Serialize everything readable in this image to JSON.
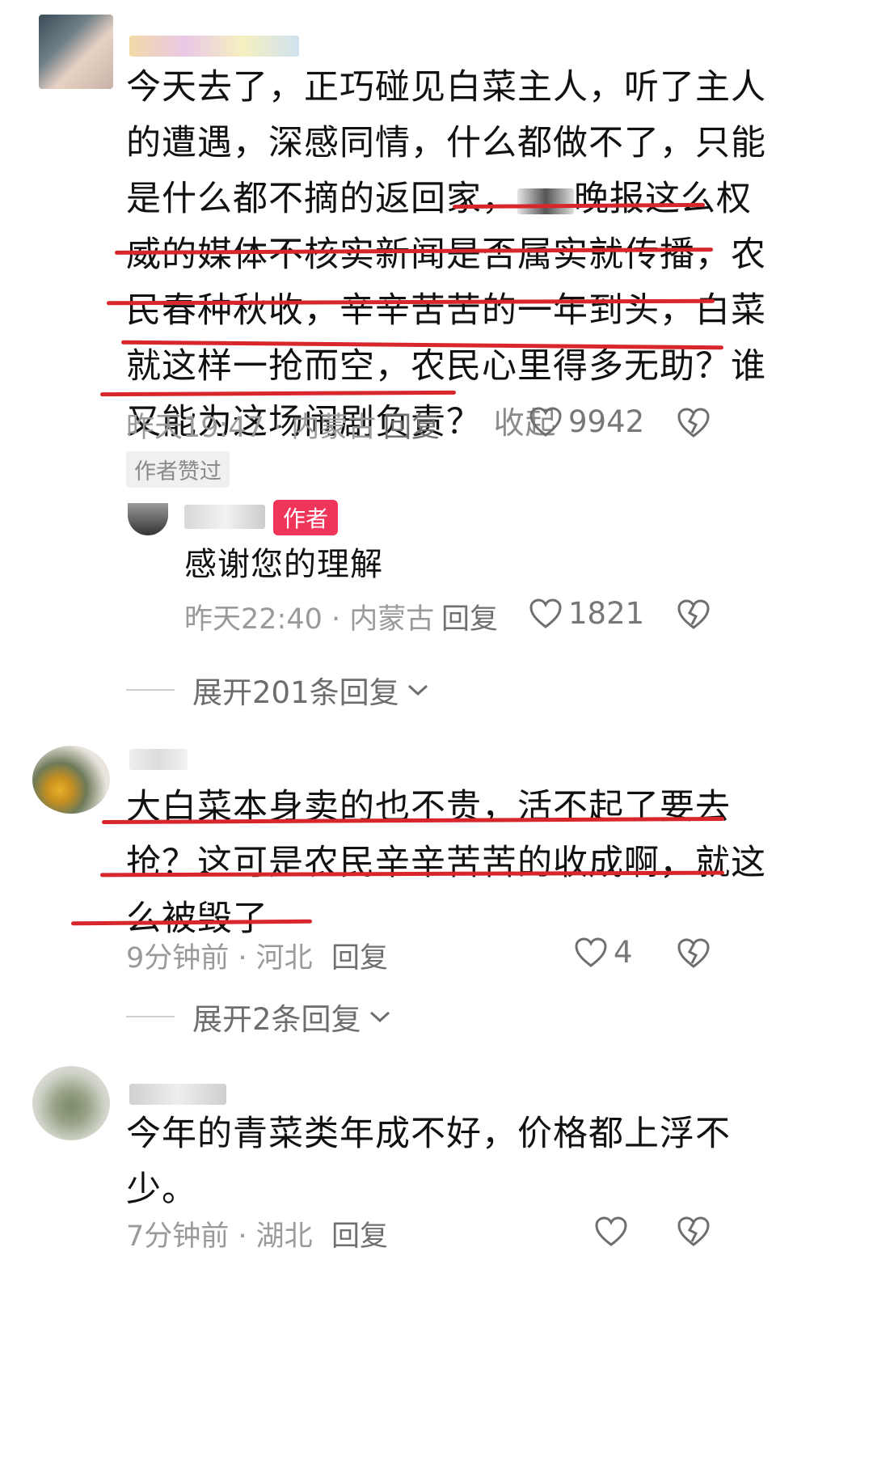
{
  "comments": [
    {
      "text_lines": [
        "今天去了，正巧碰见白菜主人，听了主人",
        "的遭遇，深感同情，什么都做不了，只能",
        "是什么都不摘的返回家，",
        "威的媒体不核实新闻是否属实就传播，农",
        "民春种秋收，辛辛苦苦的一年到头，白菜",
        "就这样一抢而空，农民心里得多无助？谁",
        "又能为这场闹剧负责？"
      ],
      "line3_tail": "晚报这么权",
      "collapse_label": "收起",
      "meta": "昨天19:47 · 内蒙古",
      "reply_label": "回复",
      "likes": "9942",
      "author_liked_badge": "作者赞过",
      "reply": {
        "author_tag": "作者",
        "text": "感谢您的理解",
        "meta": "昨天22:40 · 内蒙古",
        "reply_label": "回复",
        "likes": "1821"
      },
      "expand_label": "展开201条回复"
    },
    {
      "text_lines": [
        "大白菜本身卖的也不贵，活不起了要去",
        "抢？这可是农民辛辛苦苦的收成啊，就这",
        "么被毁了"
      ],
      "meta": "9分钟前 · 河北",
      "reply_label": "回复",
      "likes": "4",
      "expand_label": "展开2条回复"
    },
    {
      "text_lines": [
        "今年的青菜类年成不好，价格都上浮不",
        "少。"
      ],
      "meta": "7分钟前 · 湖北",
      "reply_label": "回复"
    }
  ],
  "colors": {
    "underline": "#d7262c",
    "author_tag": "#f0355a",
    "meta_text": "#9a9a9a"
  },
  "icons": [
    "heart-icon",
    "broken-heart-icon",
    "chevron-down-icon"
  ]
}
